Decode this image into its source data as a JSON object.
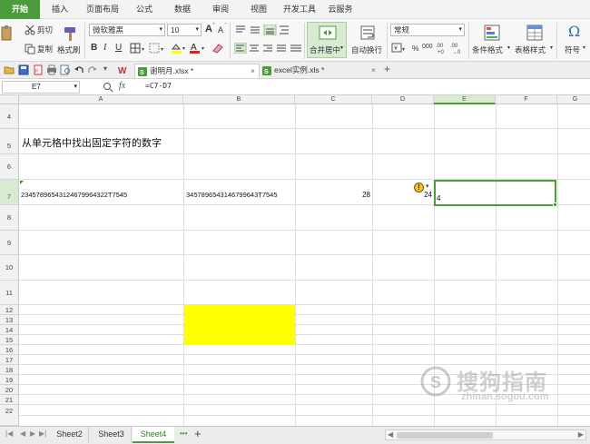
{
  "menu": {
    "tabs": [
      "开始",
      "插入",
      "页面布局",
      "公式",
      "数据",
      "审阅",
      "视图",
      "开发工具",
      "云服务"
    ],
    "active_index": 0
  },
  "ribbon": {
    "cut": "剪切",
    "copy": "复制",
    "format_painter": "格式刷",
    "font_name": "微软雅黑",
    "font_size": "10",
    "merge_center": "合并居中",
    "wrap_text": "自动换行",
    "number_format": "常规",
    "percent": "%",
    "thousands": "000",
    "conditional_format": "条件格式",
    "table_style": "表格样式",
    "symbol": "符号",
    "bold": "B",
    "italic": "I",
    "underline": "U",
    "grow_font": "A",
    "shrink_font": "A",
    "inc_decimal": ".00\n+0",
    "dec_decimal": ".00\n→0"
  },
  "documents": {
    "tabs": [
      {
        "label": "谢明月.xlsx *",
        "active": true
      },
      {
        "label": "excel实例.xls *",
        "active": false
      }
    ],
    "close_glyph": "×",
    "add_glyph": "+"
  },
  "formula_bar": {
    "cell_ref": "E7",
    "fx": "fx",
    "formula": "=C7-D7"
  },
  "grid": {
    "columns": [
      "A",
      "B",
      "C",
      "D",
      "E",
      "F",
      "G"
    ],
    "selected_column": "E",
    "rows": [
      "4",
      "5",
      "6",
      "7",
      "8",
      "9",
      "10",
      "11",
      "12",
      "13",
      "14",
      "15",
      "16",
      "17",
      "18",
      "19",
      "20",
      "21",
      "22"
    ],
    "selected_row": "7",
    "cells": {
      "A5": "从单元格中找出固定字符的数字",
      "A7": "23457896543124679964322T7545",
      "B7": "3457896543146799643T7545",
      "C7": "28",
      "D7": "24",
      "E7": "4"
    },
    "highlight_color": "#ffff00",
    "warning_icon": "!"
  },
  "sheets": {
    "tabs": [
      "Sheet2",
      "Sheet3",
      "Sheet4"
    ],
    "active": "Sheet4",
    "more_glyph": "•••",
    "add_glyph": "+"
  },
  "watermark": {
    "main": "搜狗指南",
    "sub": "zhinan.sogou.com"
  },
  "colors": {
    "accent": "#4a9d3a",
    "accent_light": "#d8ebd2",
    "highlight": "#ffff00"
  }
}
